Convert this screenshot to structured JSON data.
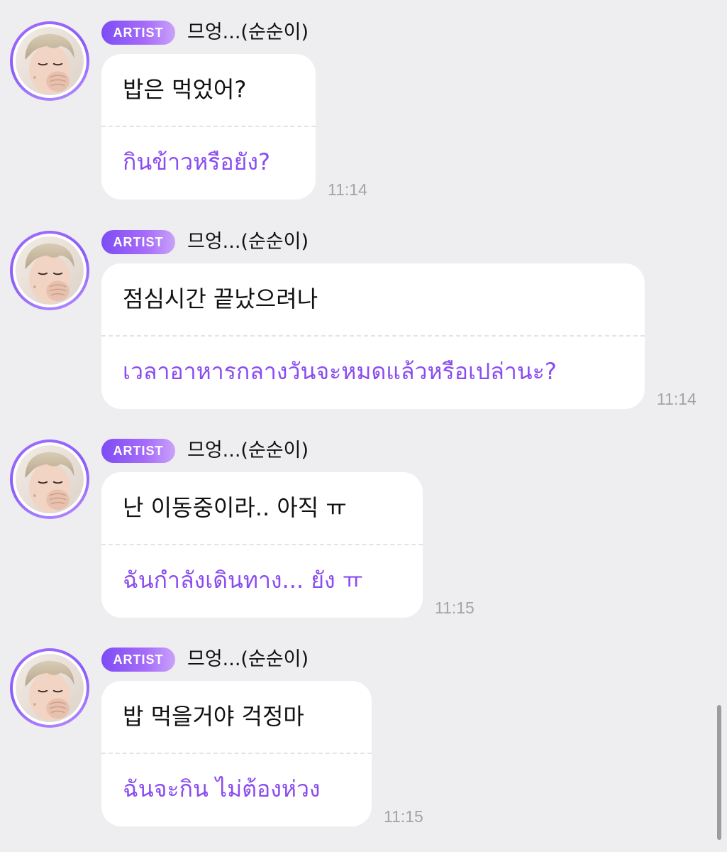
{
  "colors": {
    "background": "#eeedf0",
    "bubble": "#ffffff",
    "accent_purple": "#8a4cf0",
    "badge_gradient_start": "#7d4cf5",
    "badge_gradient_end": "#c9a2fa",
    "timestamp": "#a4a3a8"
  },
  "icons": {
    "avatar": "profile-photo"
  },
  "messages": [
    {
      "badge": "ARTIST",
      "sender": "므엉...(순순이)",
      "text_korean": "밥은 먹었어?",
      "text_thai": "กินข้าวหรือยัง?",
      "time": "11:14"
    },
    {
      "badge": "ARTIST",
      "sender": "므엉...(순순이)",
      "text_korean": "점심시간 끝났으려나",
      "text_thai": "เวลาอาหารกลางวันจะหมดแล้วหรือเปล่านะ?",
      "time": "11:14"
    },
    {
      "badge": "ARTIST",
      "sender": "므엉...(순순이)",
      "text_korean": "난 이동중이라.. 아직 ㅠ",
      "text_thai": "ฉันกำลังเดินทาง... ยัง ㅠ",
      "time": "11:15"
    },
    {
      "badge": "ARTIST",
      "sender": "므엉...(순순이)",
      "text_korean": "밥 먹을거야 걱정마",
      "text_thai": "ฉันจะกิน ไม่ต้องห่วง",
      "time": "11:15"
    }
  ]
}
